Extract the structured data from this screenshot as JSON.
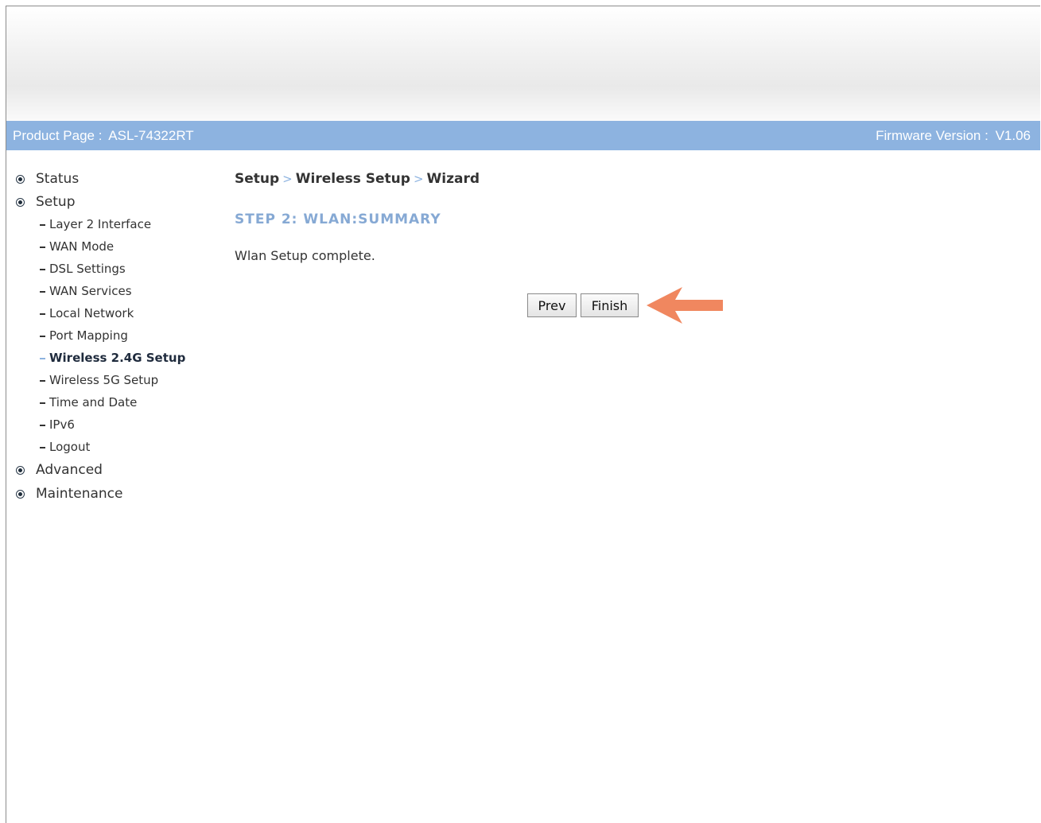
{
  "header": {
    "product_label": "Product Page :",
    "product_value": "ASL-74322RT",
    "firmware_label": "Firmware Version :",
    "firmware_value": "V1.06"
  },
  "sidebar": {
    "top_items": [
      {
        "label": "Status"
      },
      {
        "label": "Setup"
      },
      {
        "label": "Advanced"
      },
      {
        "label": "Maintenance"
      }
    ],
    "setup_items": [
      {
        "label": "Layer 2 Interface"
      },
      {
        "label": "WAN Mode"
      },
      {
        "label": "DSL Settings"
      },
      {
        "label": "WAN Services"
      },
      {
        "label": "Local Network"
      },
      {
        "label": "Port Mapping"
      },
      {
        "label": "Wireless 2.4G Setup",
        "active": true
      },
      {
        "label": "Wireless 5G Setup"
      },
      {
        "label": "Time and Date"
      },
      {
        "label": "IPv6"
      },
      {
        "label": "Logout"
      }
    ]
  },
  "breadcrumb": {
    "items": [
      "Setup",
      "Wireless Setup",
      "Wizard"
    ],
    "separator": ">"
  },
  "main": {
    "step_title": "STEP 2: WLAN:SUMMARY",
    "message": "Wlan Setup complete.",
    "prev_label": "Prev",
    "finish_label": "Finish"
  },
  "colors": {
    "titlebar": "#8db3e0",
    "step_title": "#86a9d4",
    "arrow": "#f0875f"
  },
  "icons": {
    "nav_bullet": "radio-bullet-icon",
    "pointer": "arrow-left-icon"
  }
}
